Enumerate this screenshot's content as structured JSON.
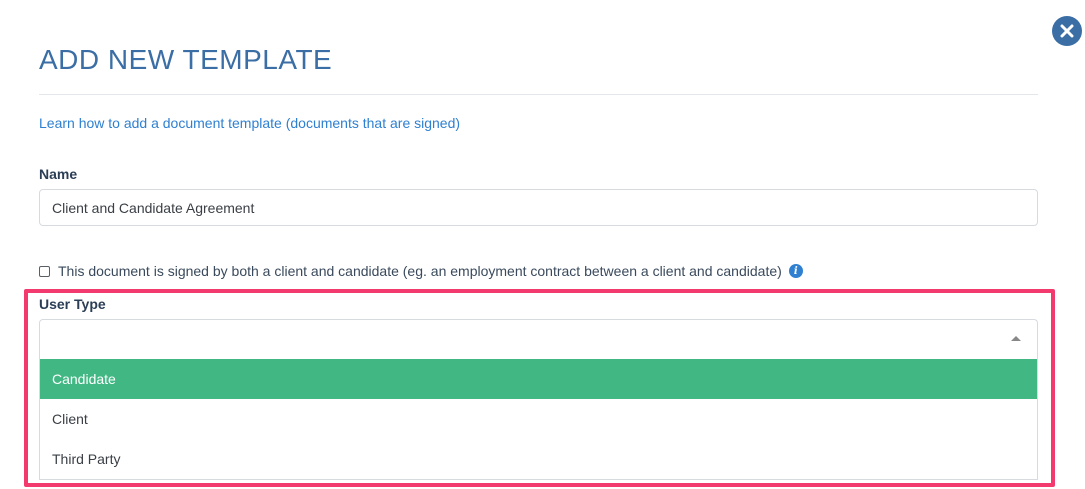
{
  "dialog": {
    "title": "ADD NEW TEMPLATE",
    "help_link": "Learn how to add a document template (documents that are signed)"
  },
  "name_field": {
    "label": "Name",
    "value": "Client and Candidate Agreement"
  },
  "signed_by_both": {
    "label": "This document is signed by both a client and candidate (eg. an employment contract between a client and candidate)",
    "checked": false
  },
  "user_type": {
    "label": "User Type",
    "value": "",
    "options": [
      {
        "label": "Candidate",
        "highlighted": true
      },
      {
        "label": "Client",
        "highlighted": false
      },
      {
        "label": "Third Party",
        "highlighted": false
      }
    ]
  },
  "colors": {
    "accent": "#3a6ea5",
    "link": "#2f80d1",
    "option_highlight": "#41b883",
    "annotation_border": "#f23a6e"
  },
  "icons": {
    "close": "close-icon",
    "info": "info-icon",
    "dropdown_arrow": "caret-up-icon"
  }
}
